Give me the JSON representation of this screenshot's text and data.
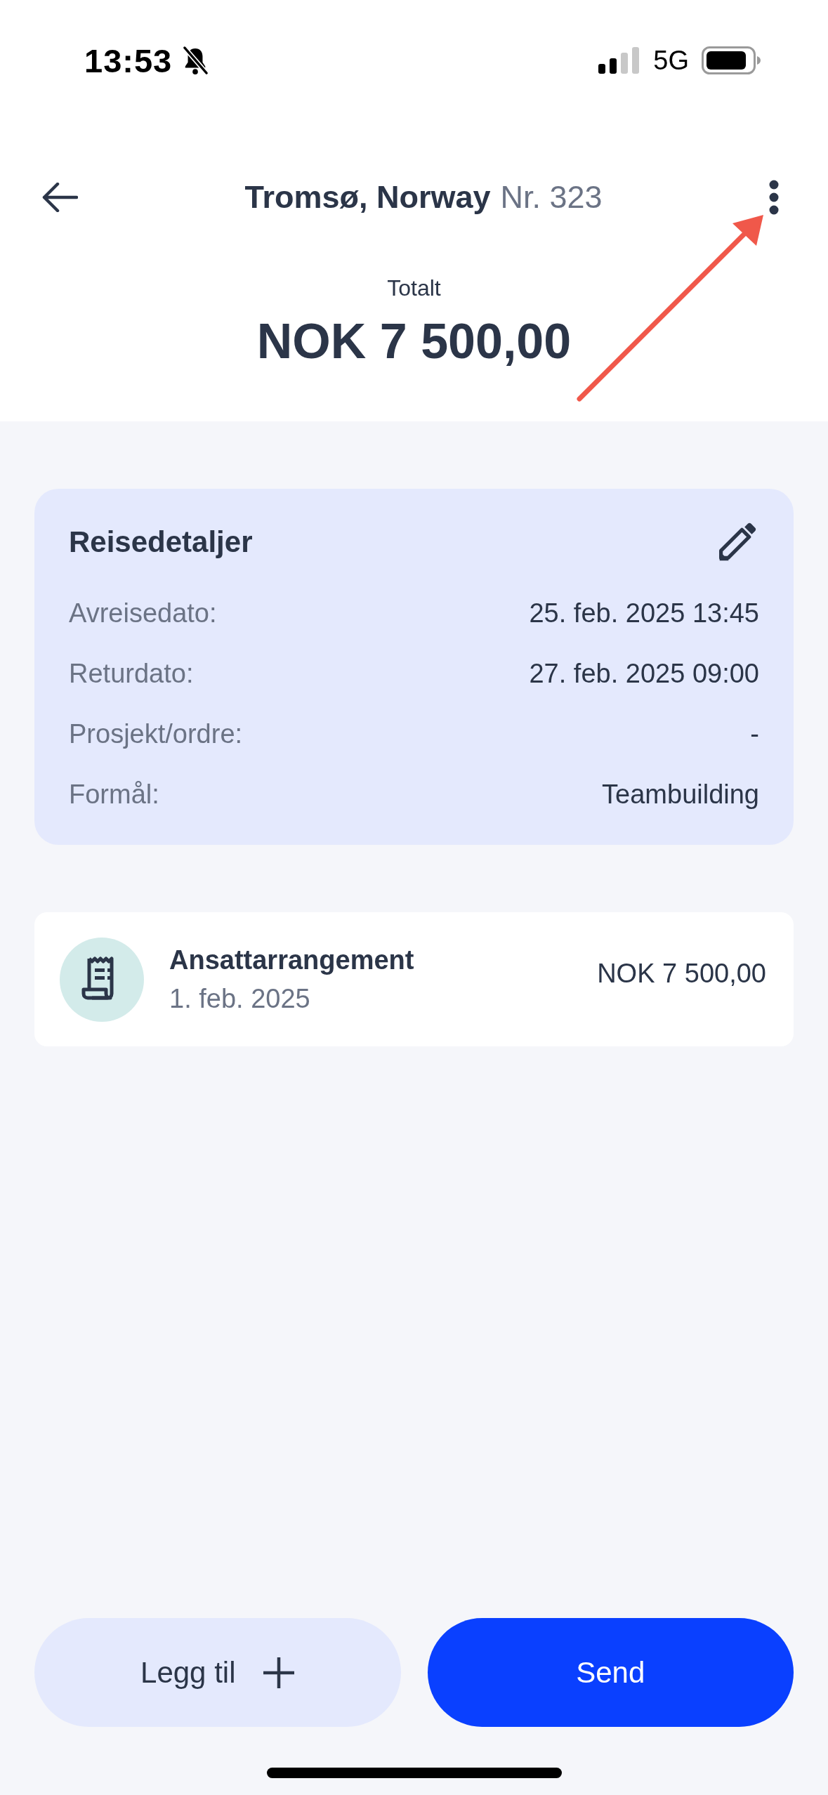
{
  "status_bar": {
    "time": "13:53",
    "network": "5G"
  },
  "header": {
    "title": "Tromsø, Norway",
    "number": "Nr. 323"
  },
  "total": {
    "label": "Totalt",
    "amount": "NOK 7 500,00"
  },
  "details": {
    "title": "Reisedetaljer",
    "rows": [
      {
        "label": "Avreisedato:",
        "value": "25. feb. 2025 13:45"
      },
      {
        "label": "Returdato:",
        "value": "27. feb. 2025 09:00"
      },
      {
        "label": "Prosjekt/ordre:",
        "value": "-"
      },
      {
        "label": "Formål:",
        "value": "Teambuilding"
      }
    ]
  },
  "expenses": [
    {
      "title": "Ansattarrangement",
      "date": "1. feb. 2025",
      "amount": "NOK 7 500,00"
    }
  ],
  "actions": [
    {
      "label": "Legg til",
      "kind": "secondary"
    },
    {
      "label": "Send",
      "kind": "primary"
    }
  ]
}
